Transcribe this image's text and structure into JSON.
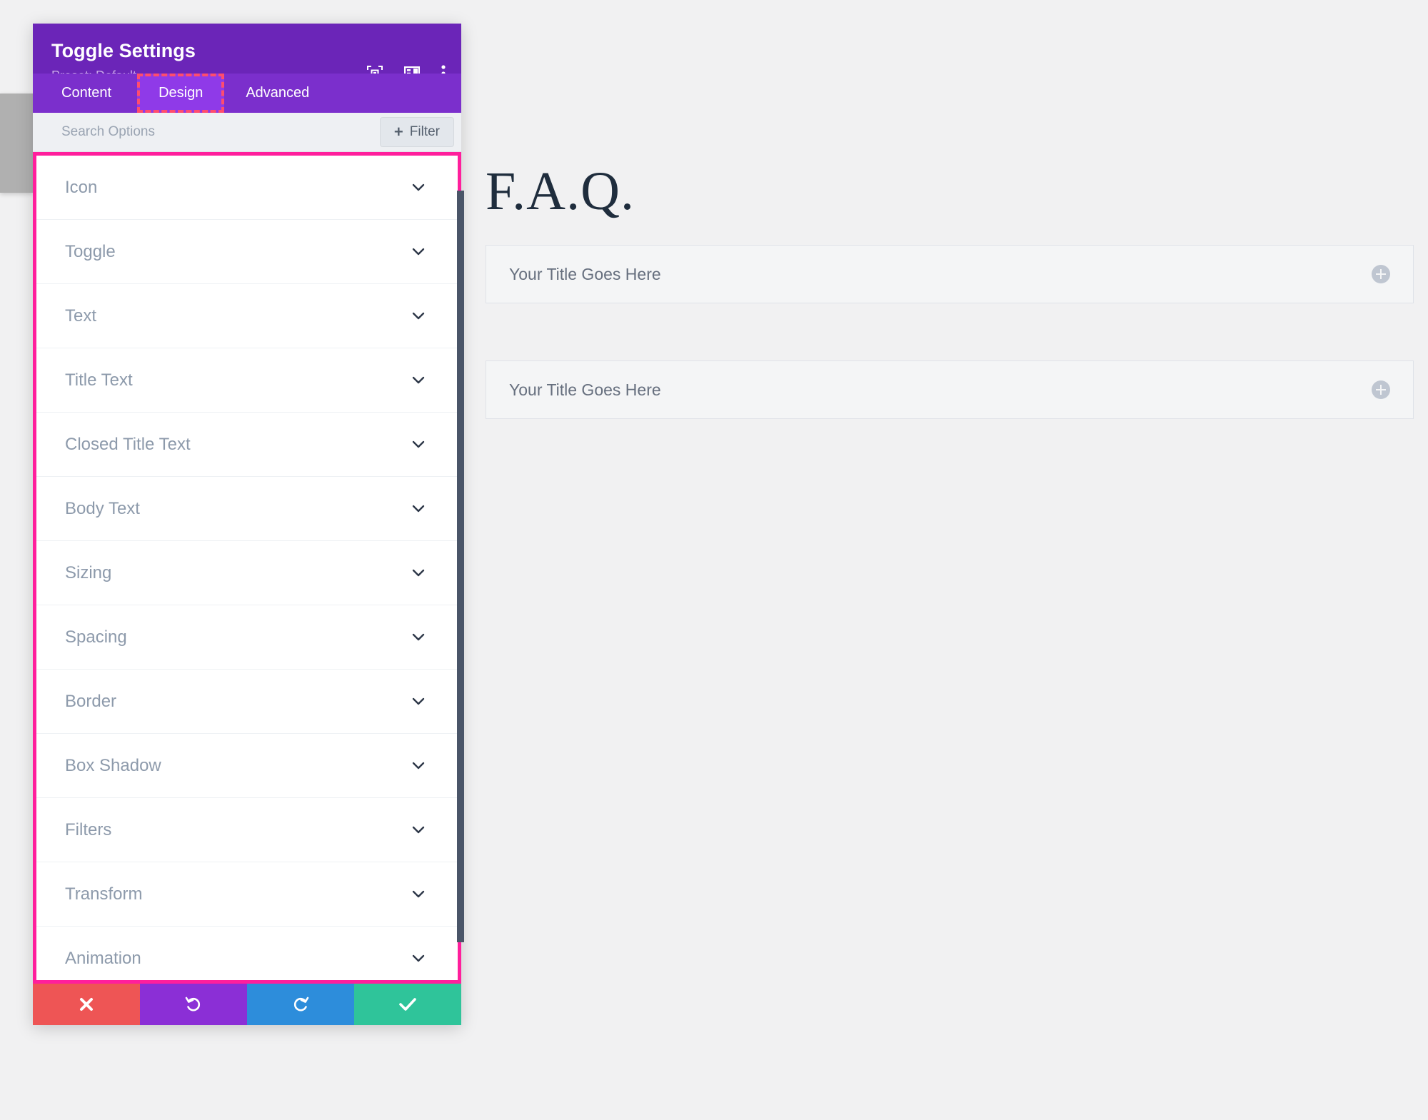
{
  "modal": {
    "title": "Toggle Settings",
    "preset_label": "Preset: Default",
    "header_icons": [
      {
        "name": "focus-frame-icon"
      },
      {
        "name": "layout-columns-icon"
      },
      {
        "name": "kebab-menu-icon"
      }
    ],
    "tabs": [
      {
        "label": "Content",
        "active": false
      },
      {
        "label": "Design",
        "active": true
      },
      {
        "label": "Advanced",
        "active": false
      }
    ],
    "search": {
      "placeholder": "Search Options",
      "value": ""
    },
    "filter_button": {
      "label": "Filter",
      "plus": "+"
    },
    "option_groups": [
      {
        "label": "Icon"
      },
      {
        "label": "Toggle"
      },
      {
        "label": "Text"
      },
      {
        "label": "Title Text"
      },
      {
        "label": "Closed Title Text"
      },
      {
        "label": "Body Text"
      },
      {
        "label": "Sizing"
      },
      {
        "label": "Spacing"
      },
      {
        "label": "Border"
      },
      {
        "label": "Box Shadow"
      },
      {
        "label": "Filters"
      },
      {
        "label": "Transform"
      },
      {
        "label": "Animation"
      }
    ],
    "footer_buttons": [
      {
        "name": "cancel-button",
        "icon": "close-icon"
      },
      {
        "name": "undo-button",
        "icon": "undo-arrow-icon"
      },
      {
        "name": "redo-button",
        "icon": "redo-arrow-icon"
      },
      {
        "name": "save-button",
        "icon": "check-icon"
      }
    ]
  },
  "page": {
    "heading": "F.A.Q.",
    "toggles": [
      {
        "title": "Your Title Goes Here",
        "state": "closed",
        "icon": "plus-circle-icon"
      },
      {
        "title": "Your Title Goes Here",
        "state": "closed",
        "icon": "plus-circle-icon"
      }
    ]
  },
  "colors": {
    "header_purple": "#6b25b8",
    "tabbar_purple": "#7b2fcc",
    "active_tab_purple": "#8f3ae8",
    "highlight_pink": "#ff1f9c",
    "dashed_outline": "#ff4d6d",
    "cancel_red": "#ee5555",
    "undo_purple": "#8b2fd6",
    "redo_blue": "#2d8ddb",
    "save_green": "#2fc49a",
    "page_bg": "#f1f1f2",
    "heading_navy": "#1f2d3d"
  }
}
